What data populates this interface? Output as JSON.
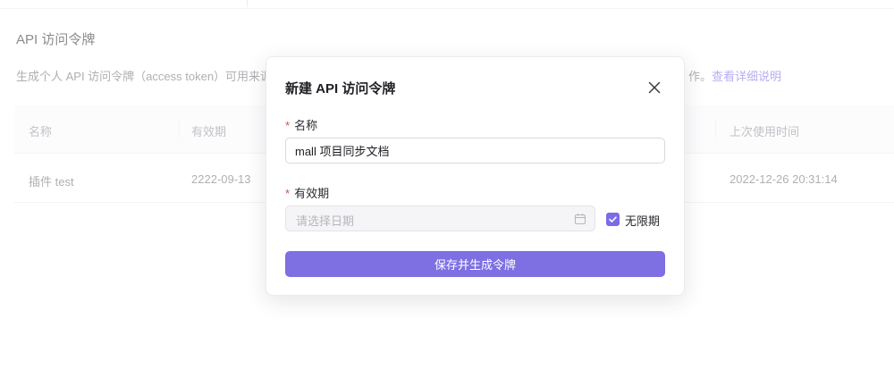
{
  "page": {
    "top_fragments": [
      "..."
    ],
    "section_title": "API 访问令牌",
    "description": "生成个人 API 访问令牌（access token）可用来调",
    "description_tail": "作。",
    "help_link": "查看详细说明",
    "table": {
      "headers": [
        "名称",
        "有效期",
        "上次使用时间"
      ],
      "rows": [
        {
          "name": "插件 test",
          "expiry": "2222-09-13",
          "last_used": "2022-12-26 20:31:14"
        }
      ]
    }
  },
  "modal": {
    "title": "新建 API 访问令牌",
    "close_icon": "close-icon",
    "required_mark": "*",
    "name_label": "名称",
    "name_value": "mall 项目同步文档",
    "expiry_label": "有效期",
    "date_placeholder": "请选择日期",
    "calendar_icon": "calendar-icon",
    "unlimited_label": "无限期",
    "unlimited_checked": true,
    "submit_label": "保存并生成令牌"
  },
  "colors": {
    "accent": "#7e6fe3",
    "link": "#7a6be6",
    "required": "#e5484d"
  }
}
